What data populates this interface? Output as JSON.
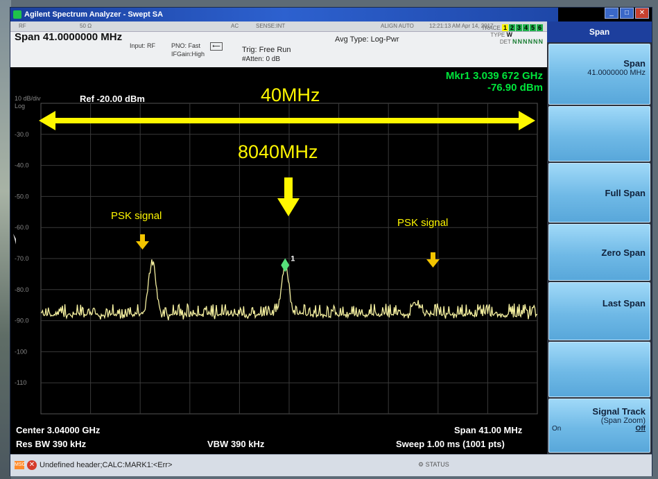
{
  "window": {
    "title": "Agilent Spectrum Analyzer - Swept SA",
    "btn_min": "_",
    "btn_max": "□",
    "btn_close": "✕"
  },
  "status": {
    "rf": "RF",
    "ohm": "50 Ω",
    "ac": "AC",
    "sense": "SENSE:INT",
    "align": "ALIGN AUTO",
    "datetime": "12:21:13 AM Apr 14, 2017",
    "span": "Span  41.0000000 MHz",
    "input": "Input: RF",
    "pno": "PNO: Fast",
    "ifgain": "IFGain:High",
    "trig": "Trig: Free Run",
    "atten": "#Atten: 0 dB",
    "avg_type": "Avg Type: Log-Pwr",
    "trace_label": "TRACE",
    "type_label": "TYPE",
    "det_label": "DET",
    "trace_nums": [
      "1",
      "2",
      "3",
      "4",
      "5",
      "6"
    ],
    "type_value": "W",
    "det_values": [
      "N",
      "N",
      "N",
      "N",
      "N",
      "N"
    ]
  },
  "plot": {
    "marker_label": "Mkr1 3.039 672 GHz",
    "marker_level": "-76.90 dBm",
    "scale_div": "10 dB/div",
    "scale_log": "Log",
    "ref_level": "Ref -20.00 dBm",
    "y_ticks": [
      "-30.0",
      "-40.0",
      "-50.0",
      "-60.0",
      "-70.0",
      "-80.0",
      "-90.0",
      "-100",
      "-110"
    ],
    "marker_number": "1"
  },
  "bottom": {
    "center": "Center 3.04000 GHz",
    "res_bw": "Res BW 390 kHz",
    "vbw": "VBW 390 kHz",
    "span": "Span 41.00 MHz",
    "sweep": "Sweep  1.00 ms (1001 pts)"
  },
  "softkeys": {
    "title": "Span",
    "span_label": "Span",
    "span_value": "41.0000000 MHz",
    "full_span": "Full Span",
    "zero_span": "Zero Span",
    "last_span": "Last Span",
    "signal_track": "Signal Track",
    "signal_track_sub": "(Span Zoom)",
    "on": "On",
    "off": "Off"
  },
  "message": {
    "badge": "MSG",
    "text": "Undefined header;CALC:MARK1:<Err>",
    "status": "STATUS"
  },
  "annotations": {
    "bandwidth": "40MHz",
    "center_freq": "8040MHz",
    "psk_left": "PSK signal",
    "psk_right": "PSK signal"
  },
  "colors": {
    "trace": "#f5f0a0",
    "marker": "#56e07a",
    "annotation": "#fff700",
    "marker_readout": "#00e53b"
  },
  "chart_data": {
    "type": "line",
    "x_range_ghz": [
      3.0195,
      3.0605
    ],
    "ylim": [
      -120,
      -20
    ],
    "center_ghz": 3.04,
    "span_mhz": 41.0,
    "peaks": [
      {
        "x_ghz": 3.0287,
        "y_dbm": -76.0
      },
      {
        "x_ghz": 3.03967,
        "y_dbm": -76.9
      },
      {
        "x_ghz": 3.0505,
        "y_dbm": -87.5
      }
    ],
    "noise_floor_dbm": -92,
    "grid": true
  }
}
